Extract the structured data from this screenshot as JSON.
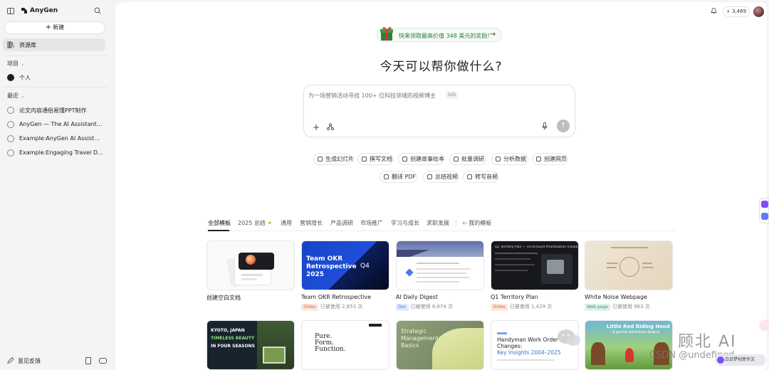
{
  "app": {
    "name": "AnyGen"
  },
  "sidebar": {
    "new_label": "新建",
    "library_label": "资源库",
    "projects_label": "项目",
    "personal_label": "个人",
    "recent_label": "最近",
    "recent_items": [
      "论文内容通俗易懂PPT制作",
      "AnyGen — The AI Assistant Buil...",
      "Example:AnyGen AI Assistant f...",
      "Example:Engaging Travel Desti..."
    ],
    "feedback_label": "意见反馈"
  },
  "header": {
    "credits": "3,469"
  },
  "promo": {
    "text": "快来领取最高价值 348 美元的奖励!"
  },
  "headline": "今天可以帮你做什么?",
  "prompt": {
    "placeholder": "为一场营销活动寻找 100+ 位科技领域的视频博主",
    "tab_hint": "tab"
  },
  "quick_actions_row1": [
    "生成幻灯片",
    "撰写文档",
    "创建故事绘本",
    "批量调研",
    "分析数据",
    "创建网页"
  ],
  "quick_actions_row2": [
    "翻译 PDF",
    "总结视频",
    "转写音频"
  ],
  "template_tabs": [
    "全部模板",
    "2025 总结",
    "通用",
    "营销增长",
    "产品调研",
    "市场推广",
    "学习与成长",
    "求职发展",
    "我的模板"
  ],
  "templates_row1": [
    {
      "title": "创建空白文档",
      "badge": "",
      "usage": ""
    },
    {
      "title": "Team OKR Retrospective",
      "badge": "Slides",
      "usage": "已被使用 2,853 次"
    },
    {
      "title": "AI Daily Digest",
      "badge": "Doc",
      "usage": "已被使用 6,674 次"
    },
    {
      "title": "Q1 Territory Plan",
      "badge": "Slides",
      "usage": "已被使用 1,429 次"
    },
    {
      "title": "White Noise Webpage",
      "badge": "Web page",
      "usage": "已被使用 963 次"
    }
  ],
  "thumb_text": {
    "okr": "Team OKR Retrospective 2025",
    "okr_q": "Q4",
    "q1": "Q1 Territory Plan — 15-Account Prioritization (Global)",
    "kyoto1": "KYOTO, JAPAN",
    "kyoto2": "TIMELESS BEAUTY",
    "kyoto3": "IN FOUR SEASONS",
    "pure1": "Pure.",
    "pure2": "Form.",
    "pure3": "Function.",
    "strategic1": "Strategic",
    "strategic2": "Management",
    "strategic3": "Basics",
    "handyman1": "Handyman Work Order",
    "handyman2": "Changes:",
    "handyman3": "Key Insights 2004–2025",
    "redhood1": "Little Red Riding Hood",
    "redhood2": "– A gentle adventure begins"
  },
  "watermark": {
    "line1": "顾北 AI",
    "line2": "CSDN @undefined",
    "chip": "白日梦创意作文"
  },
  "colors": {
    "accent_green": "#2b7a3b",
    "okr_blue": "#1f4fd8",
    "badge_slides": "#d2653c",
    "badge_doc": "#3d6fd6",
    "badge_web": "#2c9b73"
  }
}
